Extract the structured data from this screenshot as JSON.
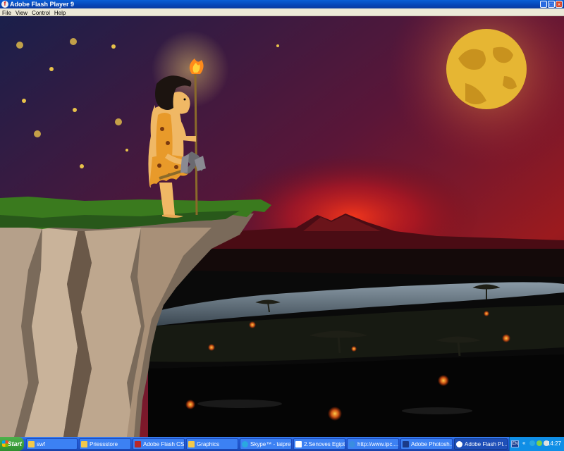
{
  "window": {
    "title": "Adobe Flash Player 9"
  },
  "menu": [
    "File",
    "View",
    "Control",
    "Help"
  ],
  "taskbar": {
    "start_label": "Start",
    "tasks": [
      {
        "label": "swf",
        "icon": "folder-icon",
        "color": "#f2c94c"
      },
      {
        "label": "Priessstore",
        "icon": "folder-icon",
        "color": "#f2c94c"
      },
      {
        "label": "Adobe Flash CS...",
        "icon": "flash-cs-icon",
        "color": "#b8282a"
      },
      {
        "label": "Graphics",
        "icon": "folder-icon",
        "color": "#f2c94c"
      },
      {
        "label": "Skype™ - taipre...",
        "icon": "skype-icon",
        "color": "#2aa8e0"
      },
      {
        "label": "2.Senoves Egipt...",
        "icon": "document-icon",
        "color": "#ffffff"
      },
      {
        "label": "http://www.ipc....",
        "icon": "internet-explorer-icon",
        "color": "#3a8de0"
      },
      {
        "label": "Adobe Photosh...",
        "icon": "photoshop-icon",
        "color": "#1b3c8a"
      },
      {
        "label": "Adobe Flash Pl...",
        "icon": "flash-player-icon",
        "color": "#ffffff",
        "active": true
      }
    ],
    "tray": {
      "lang": "EN",
      "clock": "14:27"
    }
  }
}
